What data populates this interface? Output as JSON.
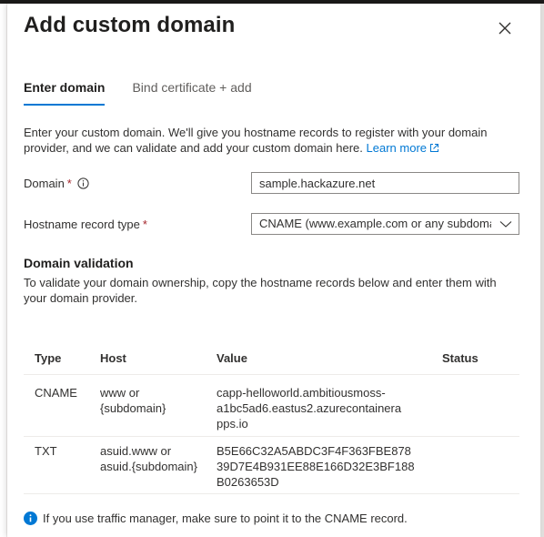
{
  "dialog": {
    "title": "Add custom domain",
    "close_label": "Close"
  },
  "tabs": [
    {
      "label": "Enter domain",
      "active": true
    },
    {
      "label": "Bind certificate + add",
      "active": false
    }
  ],
  "intro": {
    "text": "Enter your custom domain. We'll give you hostname records to register with your domain provider, and we can validate and add your custom domain here.",
    "link": "Learn more"
  },
  "form": {
    "domain_label": "Domain",
    "domain_required": "*",
    "domain_value": "sample.hackazure.net",
    "record_type_label": "Hostname record type",
    "record_type_required": "*",
    "record_type_value": "CNAME (www.example.com or any subdomain)"
  },
  "validation": {
    "heading": "Domain validation",
    "description": "To validate your domain ownership, copy the hostname records below and enter them with your domain provider."
  },
  "table": {
    "columns": [
      "Type",
      "Host",
      "Value",
      "Status"
    ],
    "rows": [
      {
        "type": "CNAME",
        "host_lines": [
          "www or",
          "{subdomain}"
        ],
        "value_lines": [
          "capp-helloworld.ambitiousmoss-",
          "a1bc5ad6.eastus2.azurecontainera",
          "pps.io"
        ],
        "status": ""
      },
      {
        "type": "TXT",
        "host_lines": [
          "asuid.www or",
          "asuid.{subdomain}"
        ],
        "value_lines": [
          "B5E66C32A5ABDC3F4F363FBE878",
          "39D7E4B931EE88E166D32E3BF188",
          "B0263653D"
        ],
        "status": ""
      }
    ]
  },
  "footer": {
    "note": "If you use traffic manager, make sure to point it to the CNAME record."
  },
  "colors": {
    "accent": "#0078d4",
    "required": "#a4262c"
  }
}
